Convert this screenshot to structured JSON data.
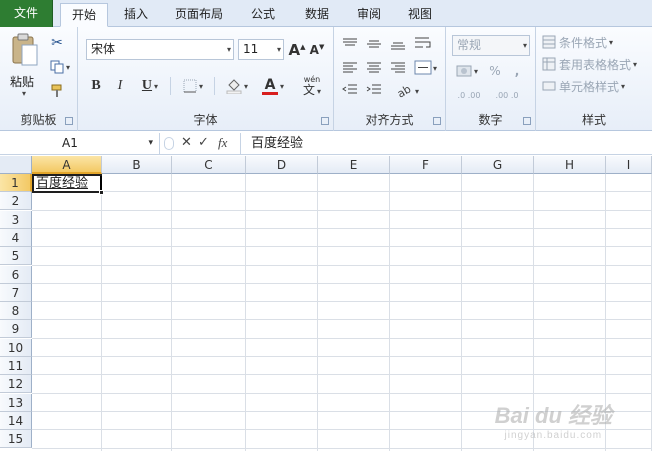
{
  "ribbon_tabs": [
    "文件",
    "开始",
    "插入",
    "页面布局",
    "公式",
    "数据",
    "审阅",
    "视图"
  ],
  "active_tab": "开始",
  "clipboard": {
    "paste_label": "粘贴",
    "group_label": "剪贴板"
  },
  "font": {
    "name": "宋体",
    "size": "11",
    "bold": "B",
    "italic": "I",
    "underline": "U",
    "font_color_glyph": "A",
    "phonetic": "wén",
    "group_label": "字体"
  },
  "alignment": {
    "group_label": "对齐方式"
  },
  "number": {
    "format": "常规",
    "percent": "%",
    "comma": ",",
    "inc_decimal": ".0 .00",
    "dec_decimal": ".00 .0",
    "group_label": "数字"
  },
  "styles": {
    "conditional": "条件格式",
    "table_format": "套用表格格式",
    "cell_styles": "单元格样式",
    "group_label": "样式"
  },
  "formula_bar": {
    "name_box": "A1",
    "fx": "fx",
    "content": "百度经验"
  },
  "grid": {
    "columns": [
      "A",
      "B",
      "C",
      "D",
      "E",
      "F",
      "G",
      "H",
      "I"
    ],
    "rows": [
      "1",
      "2",
      "3",
      "4",
      "5",
      "6",
      "7",
      "8",
      "9",
      "10",
      "11",
      "12",
      "13",
      "14",
      "15"
    ],
    "selected_cell": "A1",
    "a1_value": "百度经验"
  },
  "watermark": {
    "main": "Bai du 经验",
    "sub": "jingyan.baidu.com"
  },
  "colors": {
    "file_tab": "#2e7d32",
    "selection_header": "#f3c965",
    "ribbon_bg": "#e7eef8"
  }
}
